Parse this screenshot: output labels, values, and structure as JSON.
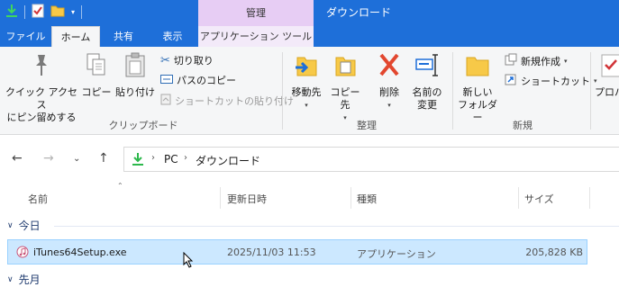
{
  "window": {
    "title": "ダウンロード",
    "context_tab_group": "管理"
  },
  "ribbon_tabs": [
    {
      "label": "ファイル"
    },
    {
      "label": "ホーム"
    },
    {
      "label": "共有"
    },
    {
      "label": "表示"
    },
    {
      "label": "アプリケーション ツール"
    }
  ],
  "ribbon": {
    "clipboard": {
      "pin_line1": "クイック アクセス",
      "pin_line2": "にピン留めする",
      "copy": "コピー",
      "paste": "貼り付け",
      "cut": "切り取り",
      "copy_path": "パスのコピー",
      "paste_shortcut": "ショートカットの貼り付け",
      "label": "クリップボード"
    },
    "organize": {
      "move_to": "移動先",
      "copy_to": "コピー先",
      "delete": "削除",
      "rename_line1": "名前の",
      "rename_line2": "変更",
      "label": "整理"
    },
    "new": {
      "new_folder_line1": "新しい",
      "new_folder_line2": "フォルダー",
      "new_item": "新規作成",
      "shortcut": "ショートカット",
      "label": "新規"
    },
    "open": {
      "properties_partial": "プロパ"
    }
  },
  "address": {
    "crumbs": [
      "PC",
      "ダウンロード"
    ]
  },
  "columns": [
    "名前",
    "更新日時",
    "種類",
    "サイズ"
  ],
  "groups": [
    {
      "label": "今日"
    },
    {
      "label": "先月"
    }
  ],
  "files": [
    {
      "name": "iTunes64Setup.exe",
      "modified": "2025/11/03 11:53",
      "type": "アプリケーション",
      "size": "205,828 KB"
    }
  ],
  "colors": {
    "titlebar": "#1e6fd9",
    "context_tab": "#e7cdf4",
    "selection": "#cce8ff",
    "selection_border": "#99d1ff"
  }
}
